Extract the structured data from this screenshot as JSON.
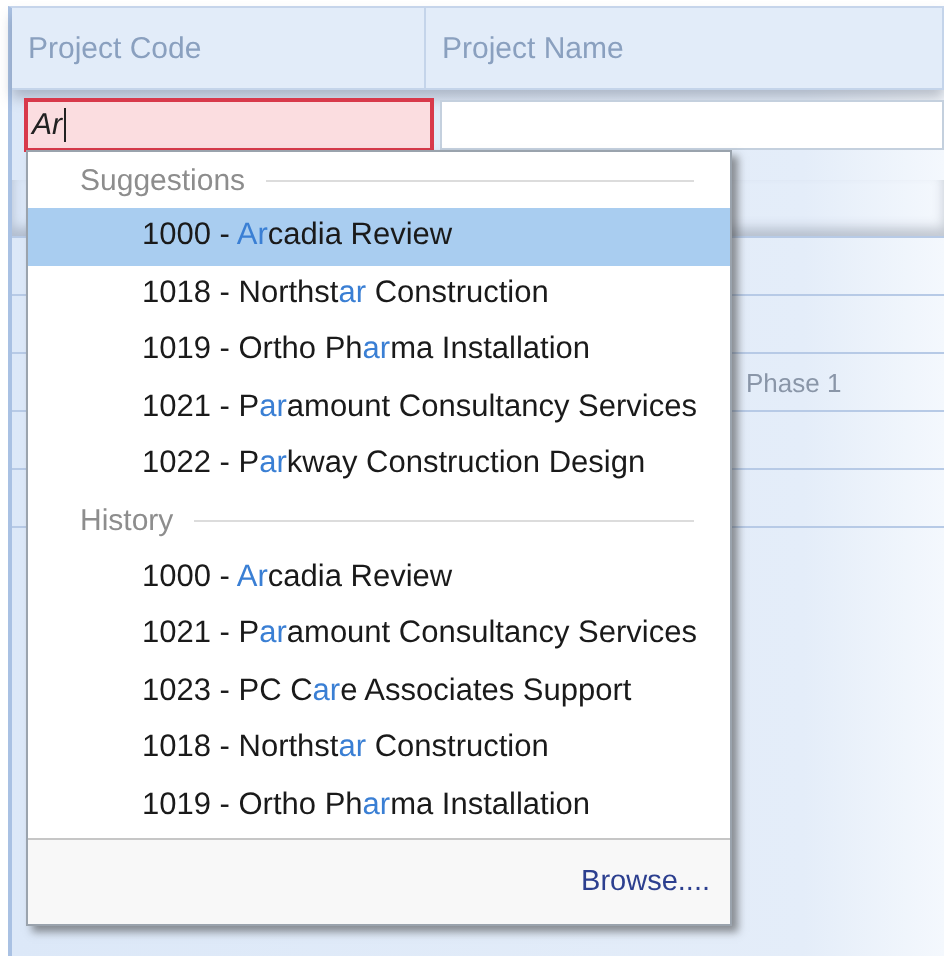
{
  "grid": {
    "columns": [
      "Project Code",
      "Project Name"
    ],
    "editor": {
      "value": "Ar",
      "invalid": true
    },
    "background_row": {
      "project_name": "Phase 1"
    }
  },
  "popup": {
    "sections": [
      {
        "title": "Suggestions",
        "items": [
          {
            "selected": true,
            "parts": [
              {
                "text": "1000 - ",
                "match": false
              },
              {
                "text": "Ar",
                "match": true
              },
              {
                "text": "cadia Review",
                "match": false
              }
            ]
          },
          {
            "selected": false,
            "parts": [
              {
                "text": "1018 - Northst",
                "match": false
              },
              {
                "text": "ar",
                "match": true
              },
              {
                "text": " Construction",
                "match": false
              }
            ]
          },
          {
            "selected": false,
            "parts": [
              {
                "text": "1019 - Ortho Ph",
                "match": false
              },
              {
                "text": "ar",
                "match": true
              },
              {
                "text": "ma Installation",
                "match": false
              }
            ]
          },
          {
            "selected": false,
            "parts": [
              {
                "text": "1021 - P",
                "match": false
              },
              {
                "text": "ar",
                "match": true
              },
              {
                "text": "amount Consultancy Services",
                "match": false
              }
            ]
          },
          {
            "selected": false,
            "parts": [
              {
                "text": "1022 - P",
                "match": false
              },
              {
                "text": "ar",
                "match": true
              },
              {
                "text": "kway Construction Design",
                "match": false
              }
            ]
          }
        ]
      },
      {
        "title": "History",
        "items": [
          {
            "selected": false,
            "parts": [
              {
                "text": "1000 - ",
                "match": false
              },
              {
                "text": "Ar",
                "match": true
              },
              {
                "text": "cadia Review",
                "match": false
              }
            ]
          },
          {
            "selected": false,
            "parts": [
              {
                "text": "1021 - P",
                "match": false
              },
              {
                "text": "ar",
                "match": true
              },
              {
                "text": "amount Consultancy Services",
                "match": false
              }
            ]
          },
          {
            "selected": false,
            "parts": [
              {
                "text": "1023 - PC C",
                "match": false
              },
              {
                "text": "ar",
                "match": true
              },
              {
                "text": "e Associates Support",
                "match": false
              }
            ]
          },
          {
            "selected": false,
            "parts": [
              {
                "text": "1018 - Northst",
                "match": false
              },
              {
                "text": "ar",
                "match": true
              },
              {
                "text": " Construction",
                "match": false
              }
            ]
          },
          {
            "selected": false,
            "parts": [
              {
                "text": "1019 - Ortho Ph",
                "match": false
              },
              {
                "text": "ar",
                "match": true
              },
              {
                "text": "ma Installation",
                "match": false
              }
            ]
          }
        ]
      }
    ],
    "footer_link": "Browse...."
  }
}
